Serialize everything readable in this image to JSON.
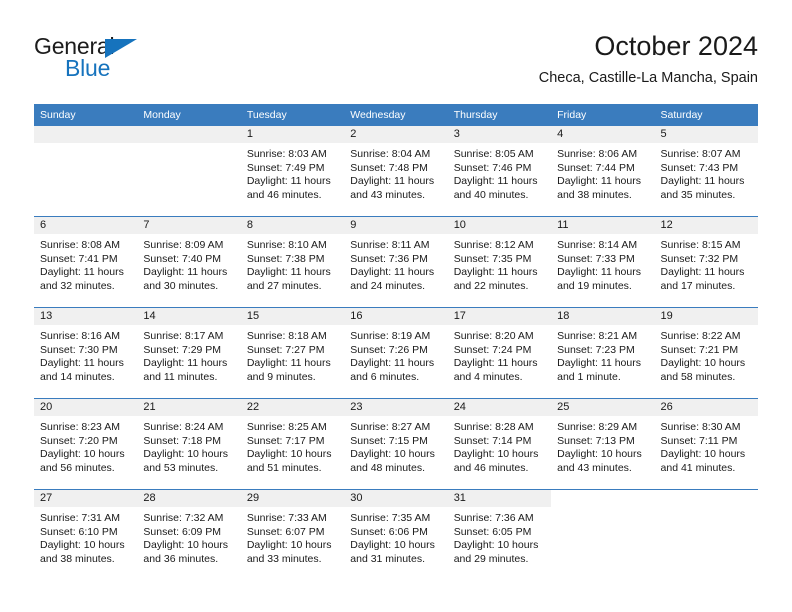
{
  "logo": {
    "word1": "General",
    "word2": "Blue",
    "triangle_color": "#1673bd",
    "icon": "triangle-icon"
  },
  "header": {
    "title": "October 2024",
    "subtitle": "Checa, Castille-La Mancha, Spain"
  },
  "colors": {
    "header_blue": "#3a7cbe",
    "daynum_band": "#f0f0f0",
    "text": "#1a1a1a",
    "logo_blue": "#1673bd"
  },
  "calendar": {
    "weekdays": [
      "Sunday",
      "Monday",
      "Tuesday",
      "Wednesday",
      "Thursday",
      "Friday",
      "Saturday"
    ],
    "weeks": [
      [
        {
          "day": "",
          "lines": []
        },
        {
          "day": "",
          "lines": []
        },
        {
          "day": "1",
          "lines": [
            "Sunrise: 8:03 AM",
            "Sunset: 7:49 PM",
            "Daylight: 11 hours",
            "and 46 minutes."
          ]
        },
        {
          "day": "2",
          "lines": [
            "Sunrise: 8:04 AM",
            "Sunset: 7:48 PM",
            "Daylight: 11 hours",
            "and 43 minutes."
          ]
        },
        {
          "day": "3",
          "lines": [
            "Sunrise: 8:05 AM",
            "Sunset: 7:46 PM",
            "Daylight: 11 hours",
            "and 40 minutes."
          ]
        },
        {
          "day": "4",
          "lines": [
            "Sunrise: 8:06 AM",
            "Sunset: 7:44 PM",
            "Daylight: 11 hours",
            "and 38 minutes."
          ]
        },
        {
          "day": "5",
          "lines": [
            "Sunrise: 8:07 AM",
            "Sunset: 7:43 PM",
            "Daylight: 11 hours",
            "and 35 minutes."
          ]
        }
      ],
      [
        {
          "day": "6",
          "lines": [
            "Sunrise: 8:08 AM",
            "Sunset: 7:41 PM",
            "Daylight: 11 hours",
            "and 32 minutes."
          ]
        },
        {
          "day": "7",
          "lines": [
            "Sunrise: 8:09 AM",
            "Sunset: 7:40 PM",
            "Daylight: 11 hours",
            "and 30 minutes."
          ]
        },
        {
          "day": "8",
          "lines": [
            "Sunrise: 8:10 AM",
            "Sunset: 7:38 PM",
            "Daylight: 11 hours",
            "and 27 minutes."
          ]
        },
        {
          "day": "9",
          "lines": [
            "Sunrise: 8:11 AM",
            "Sunset: 7:36 PM",
            "Daylight: 11 hours",
            "and 24 minutes."
          ]
        },
        {
          "day": "10",
          "lines": [
            "Sunrise: 8:12 AM",
            "Sunset: 7:35 PM",
            "Daylight: 11 hours",
            "and 22 minutes."
          ]
        },
        {
          "day": "11",
          "lines": [
            "Sunrise: 8:14 AM",
            "Sunset: 7:33 PM",
            "Daylight: 11 hours",
            "and 19 minutes."
          ]
        },
        {
          "day": "12",
          "lines": [
            "Sunrise: 8:15 AM",
            "Sunset: 7:32 PM",
            "Daylight: 11 hours",
            "and 17 minutes."
          ]
        }
      ],
      [
        {
          "day": "13",
          "lines": [
            "Sunrise: 8:16 AM",
            "Sunset: 7:30 PM",
            "Daylight: 11 hours",
            "and 14 minutes."
          ]
        },
        {
          "day": "14",
          "lines": [
            "Sunrise: 8:17 AM",
            "Sunset: 7:29 PM",
            "Daylight: 11 hours",
            "and 11 minutes."
          ]
        },
        {
          "day": "15",
          "lines": [
            "Sunrise: 8:18 AM",
            "Sunset: 7:27 PM",
            "Daylight: 11 hours",
            "and 9 minutes."
          ]
        },
        {
          "day": "16",
          "lines": [
            "Sunrise: 8:19 AM",
            "Sunset: 7:26 PM",
            "Daylight: 11 hours",
            "and 6 minutes."
          ]
        },
        {
          "day": "17",
          "lines": [
            "Sunrise: 8:20 AM",
            "Sunset: 7:24 PM",
            "Daylight: 11 hours",
            "and 4 minutes."
          ]
        },
        {
          "day": "18",
          "lines": [
            "Sunrise: 8:21 AM",
            "Sunset: 7:23 PM",
            "Daylight: 11 hours",
            "and 1 minute."
          ]
        },
        {
          "day": "19",
          "lines": [
            "Sunrise: 8:22 AM",
            "Sunset: 7:21 PM",
            "Daylight: 10 hours",
            "and 58 minutes."
          ]
        }
      ],
      [
        {
          "day": "20",
          "lines": [
            "Sunrise: 8:23 AM",
            "Sunset: 7:20 PM",
            "Daylight: 10 hours",
            "and 56 minutes."
          ]
        },
        {
          "day": "21",
          "lines": [
            "Sunrise: 8:24 AM",
            "Sunset: 7:18 PM",
            "Daylight: 10 hours",
            "and 53 minutes."
          ]
        },
        {
          "day": "22",
          "lines": [
            "Sunrise: 8:25 AM",
            "Sunset: 7:17 PM",
            "Daylight: 10 hours",
            "and 51 minutes."
          ]
        },
        {
          "day": "23",
          "lines": [
            "Sunrise: 8:27 AM",
            "Sunset: 7:15 PM",
            "Daylight: 10 hours",
            "and 48 minutes."
          ]
        },
        {
          "day": "24",
          "lines": [
            "Sunrise: 8:28 AM",
            "Sunset: 7:14 PM",
            "Daylight: 10 hours",
            "and 46 minutes."
          ]
        },
        {
          "day": "25",
          "lines": [
            "Sunrise: 8:29 AM",
            "Sunset: 7:13 PM",
            "Daylight: 10 hours",
            "and 43 minutes."
          ]
        },
        {
          "day": "26",
          "lines": [
            "Sunrise: 8:30 AM",
            "Sunset: 7:11 PM",
            "Daylight: 10 hours",
            "and 41 minutes."
          ]
        }
      ],
      [
        {
          "day": "27",
          "lines": [
            "Sunrise: 7:31 AM",
            "Sunset: 6:10 PM",
            "Daylight: 10 hours",
            "and 38 minutes."
          ]
        },
        {
          "day": "28",
          "lines": [
            "Sunrise: 7:32 AM",
            "Sunset: 6:09 PM",
            "Daylight: 10 hours",
            "and 36 minutes."
          ]
        },
        {
          "day": "29",
          "lines": [
            "Sunrise: 7:33 AM",
            "Sunset: 6:07 PM",
            "Daylight: 10 hours",
            "and 33 minutes."
          ]
        },
        {
          "day": "30",
          "lines": [
            "Sunrise: 7:35 AM",
            "Sunset: 6:06 PM",
            "Daylight: 10 hours",
            "and 31 minutes."
          ]
        },
        {
          "day": "31",
          "lines": [
            "Sunrise: 7:36 AM",
            "Sunset: 6:05 PM",
            "Daylight: 10 hours",
            "and 29 minutes."
          ]
        },
        {
          "day": "",
          "lines": []
        },
        {
          "day": "",
          "lines": []
        }
      ]
    ]
  }
}
